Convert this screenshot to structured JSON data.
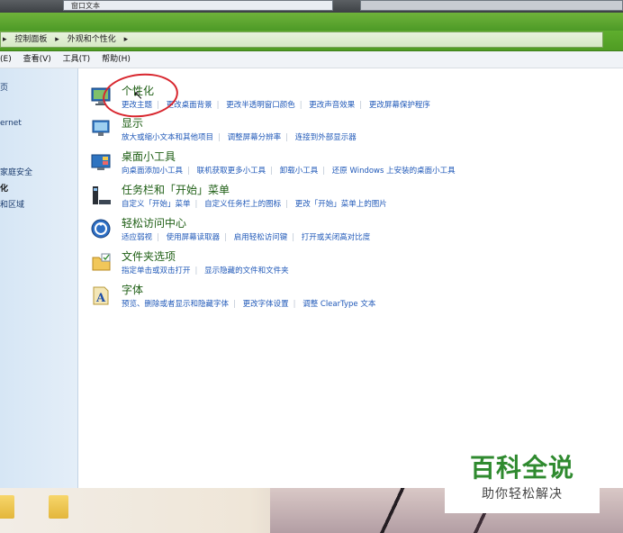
{
  "top": {
    "behind_window_title": "窗口文本"
  },
  "address_bar": {
    "items": [
      "控制面板",
      "外观和个性化"
    ]
  },
  "menu_bar": {
    "items": [
      "(E)",
      "查看(V)",
      "工具(T)",
      "帮助(H)"
    ]
  },
  "left_pane": {
    "items": [
      {
        "label": "页",
        "bold": false
      },
      {
        "label": "ernet",
        "bold": false
      },
      {
        "label": "家庭安全",
        "bold": false
      },
      {
        "label": "化",
        "bold": true
      },
      {
        "label": "和区域",
        "bold": false
      }
    ]
  },
  "categories": [
    {
      "title": "个性化",
      "links": [
        "更改主题",
        "更改桌面背景",
        "更改半透明窗口颜色",
        "更改声音效果",
        "更改屏幕保护程序"
      ]
    },
    {
      "title": "显示",
      "links": [
        "放大或缩小文本和其他项目",
        "调整屏幕分辨率",
        "连接到外部显示器"
      ]
    },
    {
      "title": "桌面小工具",
      "links": [
        "向桌面添加小工具",
        "联机获取更多小工具",
        "卸载小工具",
        "还原 Windows 上安装的桌面小工具"
      ]
    },
    {
      "title": "任务栏和「开始」菜单",
      "links": [
        "自定义「开始」菜单",
        "自定义任务栏上的图标",
        "更改「开始」菜单上的图片"
      ]
    },
    {
      "title": "轻松访问中心",
      "links": [
        "适应弱视",
        "使用屏幕读取器",
        "启用轻松访问键",
        "打开或关闭高对比度"
      ]
    },
    {
      "title": "文件夹选项",
      "links": [
        "指定单击或双击打开",
        "显示隐藏的文件和文件夹"
      ]
    },
    {
      "title": "字体",
      "links": [
        "预览、删除或者显示和隐藏字体",
        "更改字体设置",
        "调整 ClearType 文本"
      ]
    }
  ],
  "watermark": {
    "logo": "百科全说",
    "sub": "助你轻松解决"
  },
  "colors": {
    "accent_green": "#4d9a27",
    "link_blue": "#1f58b8",
    "title_green": "#1e5e14",
    "annotation_red": "#d8262e"
  }
}
